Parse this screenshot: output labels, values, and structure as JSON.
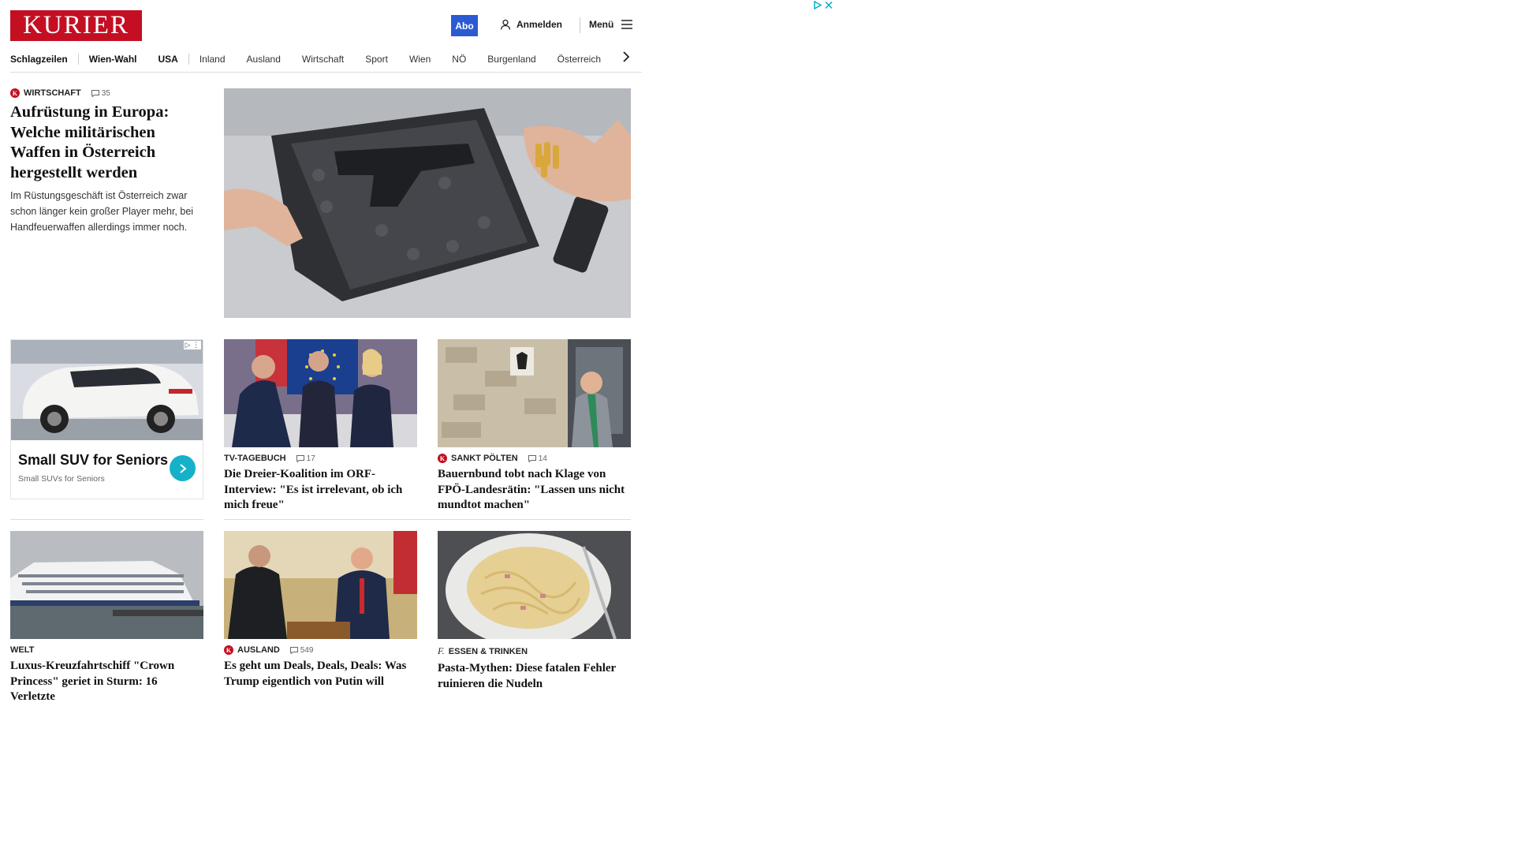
{
  "header": {
    "logo": "KURIER",
    "abo": "Abo",
    "login": "Anmelden",
    "menu": "Menü"
  },
  "nav": {
    "items": [
      "Schlagzeilen",
      "Wien-Wahl",
      "USA",
      "Inland",
      "Ausland",
      "Wirtschaft",
      "Sport",
      "Wien",
      "NÖ",
      "Burgenland",
      "Österreich"
    ]
  },
  "lead": {
    "kicker": "WIRTSCHAFT",
    "comments": "35",
    "title": "Aufrüstung in Europa: Welche militärischen Waffen in Österreich hergestellt werden",
    "teaser": "Im Rüstungsgeschäft ist Österreich zwar schon länger kein großer Player mehr, bei Handfeuerwaffen allerdings immer noch."
  },
  "ad": {
    "title": "Small SUV for Seniors",
    "subtitle": "Small SUVs for Seniors"
  },
  "cards": [
    {
      "kicker": "TV-TAGEBUCH",
      "comments": "17",
      "title": "Die Dreier-Koalition im ORF-Interview: \"Es ist irrelevant, ob ich mich freue\""
    },
    {
      "kicker": "SANKT PÖLTEN",
      "comments": "14",
      "title": "Bauernbund tobt nach Klage von FPÖ-Landesrätin: \"Lassen uns nicht mundtot machen\""
    },
    {
      "kicker": "WELT",
      "comments": "",
      "title": "Luxus-Kreuzfahrtschiff \"Crown Princess\" geriet in Sturm: 16 Verletzte"
    },
    {
      "kicker": "AUSLAND",
      "comments": "549",
      "title": "Es geht um Deals, Deals, Deals: Was Trump eigentlich von Putin will"
    },
    {
      "kicker": "ESSEN & TRINKEN",
      "comments": "",
      "title": "Pasta-Mythen: Diese fatalen Fehler ruinieren die Nudeln"
    }
  ],
  "colors": {
    "brand": "#c40f23",
    "abo": "#2b5ad3",
    "ad_button": "#14b1c9"
  }
}
